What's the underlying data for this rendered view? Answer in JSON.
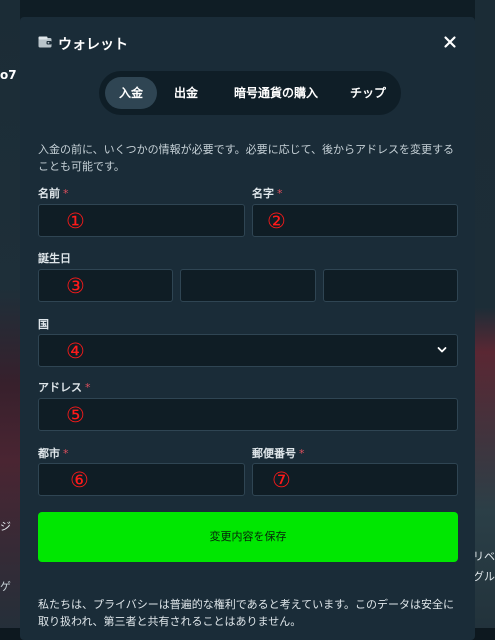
{
  "background": {
    "left_text_top": "o7",
    "left_text_middle": "ジ",
    "left_text_bottom": "ゲ",
    "right_text_top": "リベ",
    "right_text_bottom": "グル"
  },
  "modal": {
    "title": "ウォレット",
    "close_icon": "close-icon",
    "wallet_icon": "wallet-icon"
  },
  "tabs": [
    {
      "label": "入金",
      "active": true
    },
    {
      "label": "出金",
      "active": false
    },
    {
      "label": "暗号通貨の購入",
      "active": false
    },
    {
      "label": "チップ",
      "active": false
    }
  ],
  "form": {
    "intro": "入金の前に、いくつかの情報が必要です。必要に応じて、後からアドレスを変更することも可能です。",
    "required_mark": "*",
    "first_name_label": "名前",
    "last_name_label": "名字",
    "birthdate_label": "誕生日",
    "country_label": "国",
    "address_label": "アドレス",
    "city_label": "都市",
    "postal_label": "郵便番号",
    "markers": [
      "①",
      "②",
      "③",
      "④",
      "⑤",
      "⑥",
      "⑦"
    ],
    "save_label": "変更内容を保存",
    "privacy_text": "私たちは、プライバシーは普遍的な権利であると考えています。このデータは安全に取り扱われ、第三者と共有されることはありません。"
  },
  "colors": {
    "accent_green": "#00e701",
    "required_red": "#e0505e",
    "marker_red": "#ff1a1a",
    "modal_bg": "#1a2c38",
    "field_bg": "#0f1d25"
  }
}
